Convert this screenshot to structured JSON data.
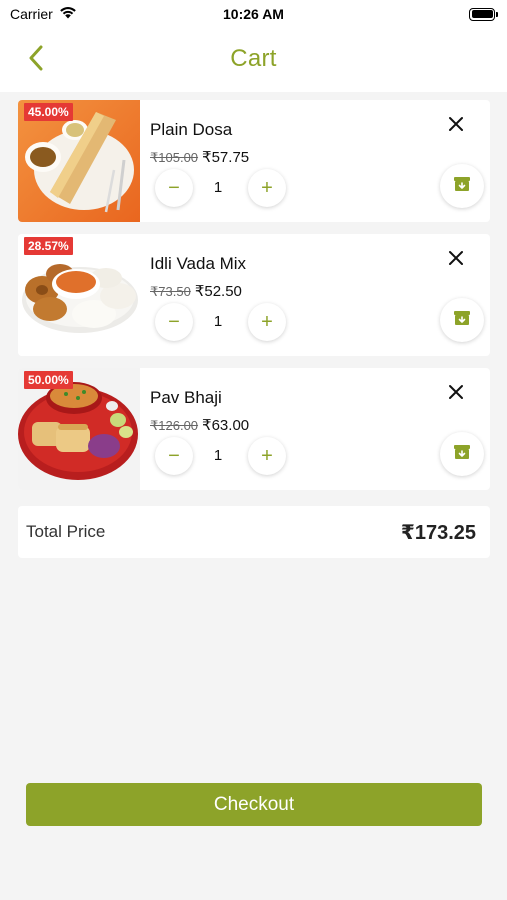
{
  "status_bar": {
    "carrier": "Carrier",
    "time": "10:26 AM"
  },
  "nav": {
    "title": "Cart",
    "back_icon": "chevron-left-icon"
  },
  "colors": {
    "accent": "#8da329",
    "discount_badge": "#e53935",
    "background": "#f4f4f4"
  },
  "cart": {
    "items": [
      {
        "discount": "45.00%",
        "name": "Plain Dosa",
        "old_price": "₹105.00",
        "new_price": "₹57.75",
        "quantity": "1",
        "minus_label": "−",
        "plus_label": "+"
      },
      {
        "discount": "28.57%",
        "name": "Idli Vada Mix",
        "old_price": "₹73.50",
        "new_price": "₹52.50",
        "quantity": "1",
        "minus_label": "−",
        "plus_label": "+"
      },
      {
        "discount": "50.00%",
        "name": "Pav Bhaji",
        "old_price": "₹126.00",
        "new_price": "₹63.00",
        "quantity": "1",
        "minus_label": "−",
        "plus_label": "+"
      }
    ]
  },
  "total": {
    "label": "Total Price",
    "value": "₹173.25"
  },
  "checkout": {
    "label": "Checkout"
  }
}
